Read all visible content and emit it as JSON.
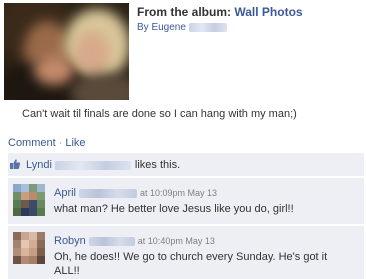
{
  "post": {
    "album_prefix": "From the album:",
    "album_name": "Wall Photos",
    "by_label": "By",
    "by_name": "Eugene",
    "caption": "Can't wait til finals are done so I can hang with my man;)"
  },
  "actions": {
    "comment": "Comment",
    "separator": "·",
    "like": "Like"
  },
  "likes": {
    "name": "Lyndi",
    "text": "likes this."
  },
  "comments": [
    {
      "name": "April",
      "meta": "at 10:09pm May 13",
      "text": "what man? He better love Jesus like you do, girl!!"
    },
    {
      "name": "Robyn",
      "meta": "at 10:40pm May 13",
      "text_line1": "Oh, he does!! We go to church every Sunday. He's got it",
      "text_line2": "ALL!!"
    }
  ],
  "colors": {
    "link": "#3b5998",
    "comment_bg": "#edeff4",
    "meta": "#808080"
  }
}
